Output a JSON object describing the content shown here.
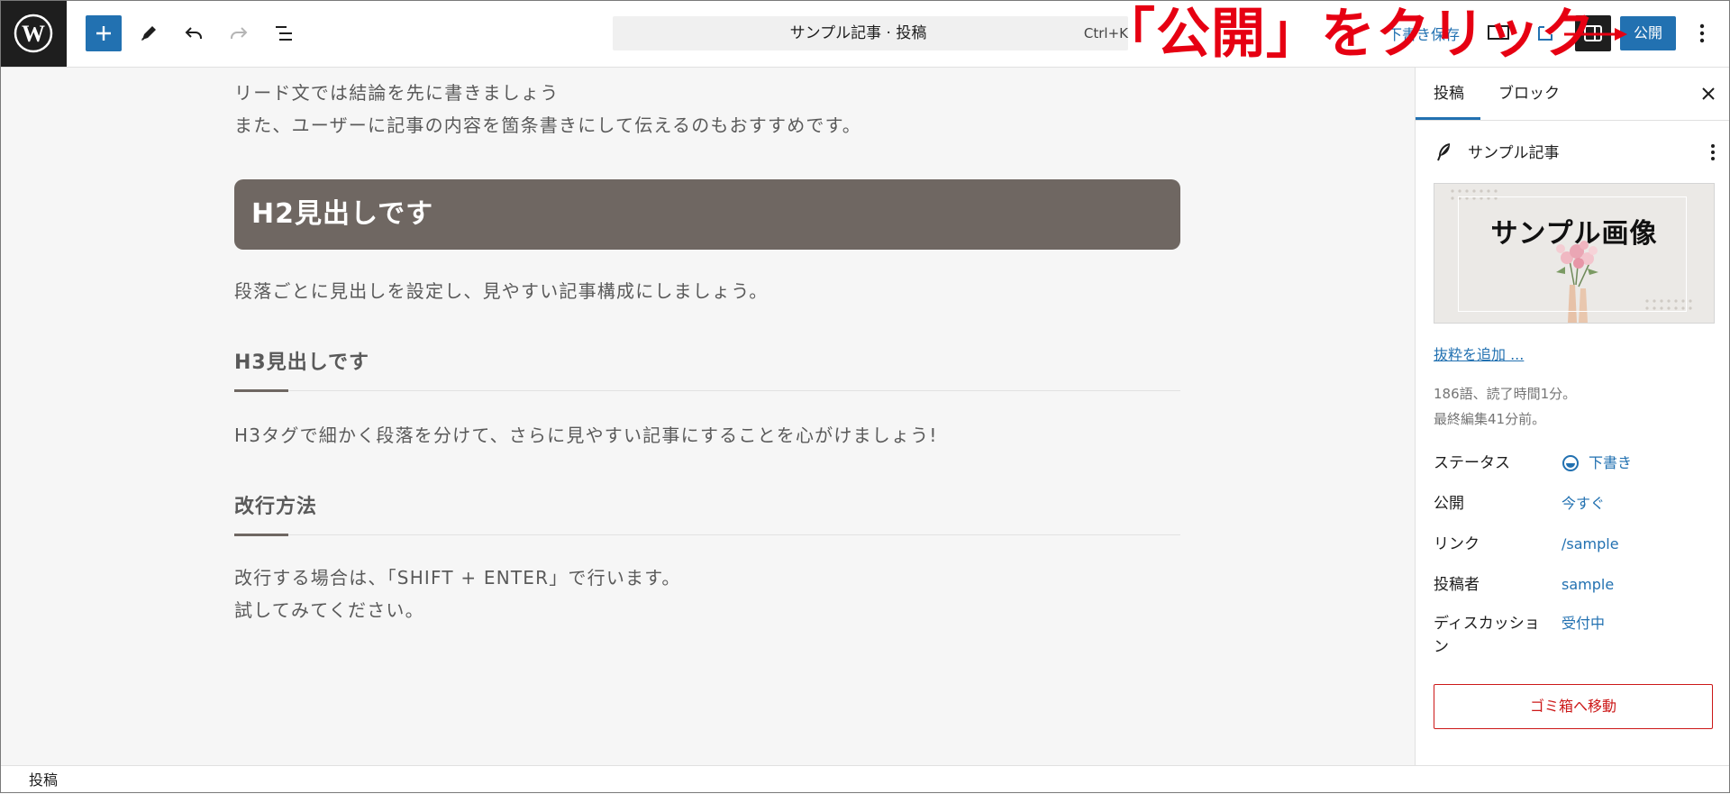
{
  "topbar": {
    "document_title": "サンプル記事 · 投稿",
    "shortcut": "Ctrl+K",
    "save_draft": "下書き保存",
    "publish": "公開",
    "colors": {
      "accent": "#2271b1",
      "dark": "#1e1e1e"
    }
  },
  "annotation": {
    "text": "「公開」をクリック",
    "color": "#e60012"
  },
  "editor": {
    "lead_line1": "リード文では結論を先に書きましょう",
    "lead_line2": "また、ユーザーに記事の内容を箇条書きにして伝えるのもおすすめです。",
    "h2": "H2見出しです",
    "para2": "段落ごとに見出しを設定し、見やすい記事構成にしましょう。",
    "h3_1": "H3見出しです",
    "para3": "H3タグで細かく段落を分けて、さらに見やすい記事にすることを心がけましょう!",
    "h3_2": "改行方法",
    "para4_line1": "改行する場合は、「SHIFT + ENTER」で行います。",
    "para4_line2": "試してみてください。"
  },
  "sidebar": {
    "tab_post": "投稿",
    "tab_block": "ブロック",
    "post_title": "サンプル記事",
    "featured_caption": "サンプル画像",
    "excerpt_link": "抜粋を追加 ...",
    "meta_line1": "186語、読了時間1分。",
    "meta_line2": "最終編集41分前。",
    "rows": [
      {
        "label": "ステータス",
        "value": "下書き"
      },
      {
        "label": "公開",
        "value": "今すぐ"
      },
      {
        "label": "リンク",
        "value": "/sample"
      },
      {
        "label": "投稿者",
        "value": "sample"
      },
      {
        "label": "ディスカッション",
        "value": "受付中"
      }
    ],
    "trash": "ゴミ箱へ移動"
  },
  "footer": {
    "breadcrumb": "投稿"
  }
}
